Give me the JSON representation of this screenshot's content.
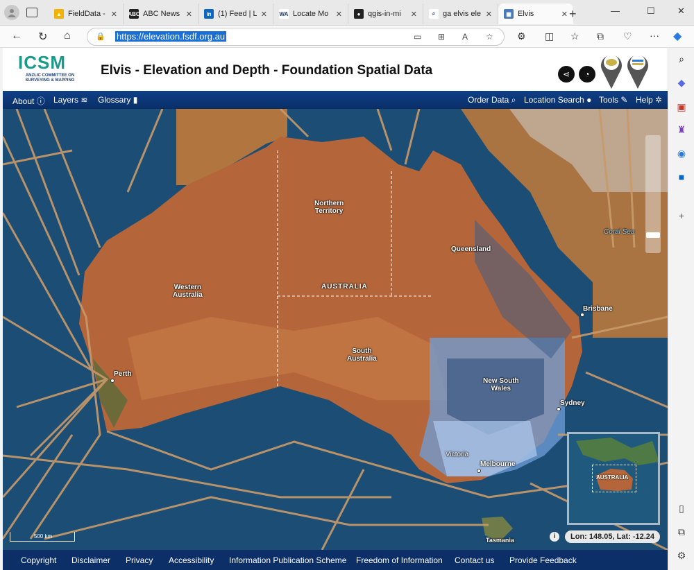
{
  "browser": {
    "tabs": [
      {
        "title": "FieldData -",
        "fav_color": "#f2b400",
        "fav": "▲"
      },
      {
        "title": "ABC News",
        "fav_color": "#222222",
        "fav": "ABC"
      },
      {
        "title": "(1) Feed | L",
        "fav_color": "#0a66c2",
        "fav": "in"
      },
      {
        "title": "Locate Mo",
        "fav_color": "#ffffff",
        "fav": "WA"
      },
      {
        "title": "qgis-in-mi",
        "fav_color": "#222222",
        "fav": "●"
      },
      {
        "title": "ga elvis ele",
        "fav_color": "#ffffff",
        "fav": "⌕"
      },
      {
        "title": "Elvis",
        "fav_color": "#4a7ab8",
        "fav": "▦"
      }
    ],
    "url": "https://elevation.fsdf.org.au"
  },
  "header": {
    "logo_main": "ICSM",
    "logo_sub": "ANZLIC COMMITTEE ON SURVEYING & MAPPING",
    "title": "Elvis - Elevation and Depth - Foundation Spatial Data"
  },
  "menu": {
    "about": "About",
    "layers": "Layers",
    "glossary": "Glossary",
    "order_data": "Order Data",
    "location_search": "Location Search",
    "tools": "Tools",
    "help": "Help"
  },
  "map": {
    "labels": {
      "coral_sea": "Coral Sea",
      "northern_territory": "Northern\nTerritory",
      "queensland": "Queensland",
      "western_australia": "Western\nAustralia",
      "australia": "AUSTRALIA",
      "south_australia": "South\nAustralia",
      "new_south_wales": "New South\nWales",
      "victoria": "Victoria",
      "tasmania": "Tasmania"
    },
    "cities": {
      "brisbane": "Brisbane",
      "perth": "Perth",
      "sydney": "Sydney",
      "melbourne": "Melbourne"
    },
    "overview_label": "AUSTRALIA",
    "scale": "500 km",
    "coordinates": "Lon: 148.05, Lat: -12.24"
  },
  "footer": {
    "copyright": "Copyright",
    "disclaimer": "Disclaimer",
    "privacy": "Privacy",
    "accessibility": "Accessibility",
    "ips": "Information Publication Scheme",
    "foi": "Freedom of Information",
    "contact": "Contact us",
    "feedback": "Provide Feedback"
  },
  "colors": {
    "land": "#b4663a",
    "ocean": "#1c4d74",
    "survey_lines": "#c89a6a",
    "overlay_blue": "#6f9fd8",
    "menu_bg": "#0e3f86"
  }
}
